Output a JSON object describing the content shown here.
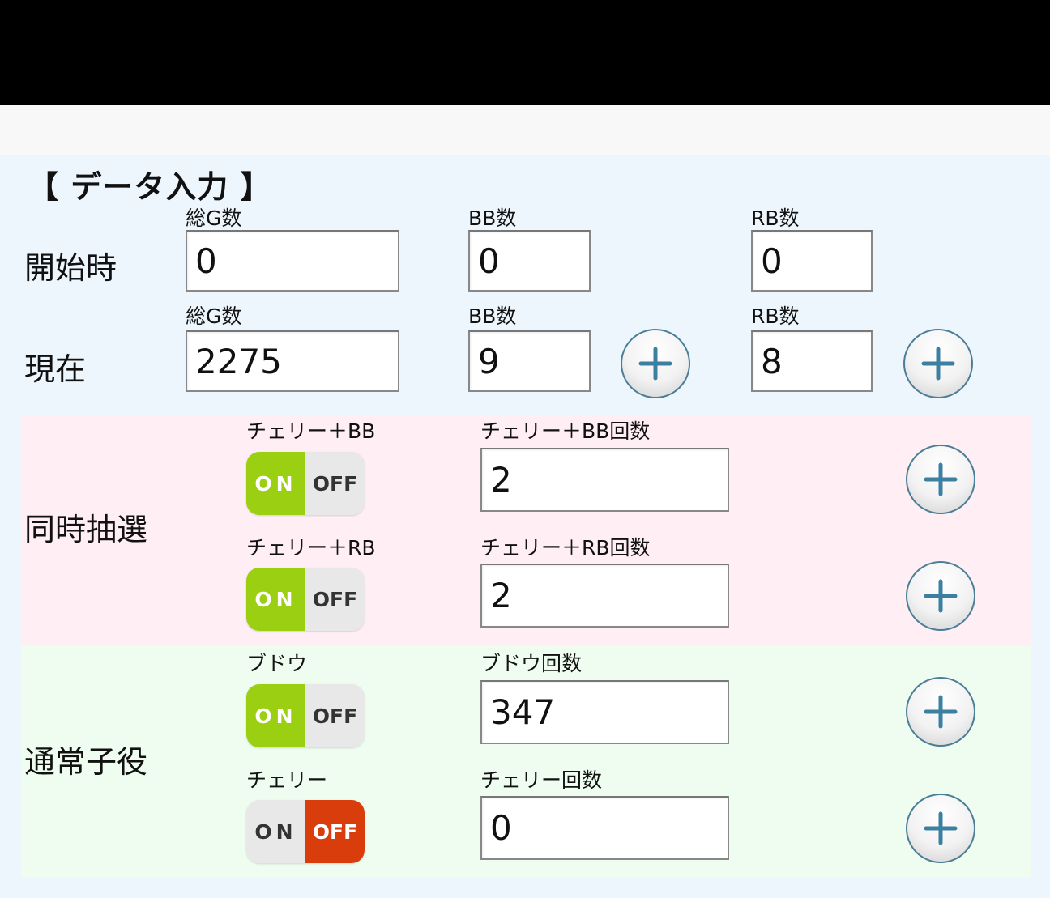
{
  "section_title": "【 データ入力 】",
  "start": {
    "row_label": "開始時",
    "total_games": {
      "label": "総G数",
      "value": "0"
    },
    "bb": {
      "label": "BB数",
      "value": "0"
    },
    "rb": {
      "label": "RB数",
      "value": "0"
    }
  },
  "current": {
    "row_label": "現在",
    "total_games": {
      "label": "総G数",
      "value": "2275"
    },
    "bb": {
      "label": "BB数",
      "value": "9"
    },
    "rb": {
      "label": "RB数",
      "value": "8"
    }
  },
  "simultaneous": {
    "row_label": "同時抽選",
    "items": [
      {
        "toggle_label": "チェリー＋BB",
        "count_label": "チェリー＋BB回数",
        "value": "2",
        "state": "on",
        "on_text": "ON",
        "off_text": "OFF"
      },
      {
        "toggle_label": "チェリー＋RB",
        "count_label": "チェリー＋RB回数",
        "value": "2",
        "state": "on",
        "on_text": "ON",
        "off_text": "OFF"
      }
    ]
  },
  "normal_roles": {
    "row_label": "通常子役",
    "items": [
      {
        "toggle_label": "ブドウ",
        "count_label": "ブドウ回数",
        "value": "347",
        "state": "on",
        "on_text": "ON",
        "off_text": "OFF"
      },
      {
        "toggle_label": "チェリー",
        "count_label": "チェリー回数",
        "value": "0",
        "state": "off",
        "on_text": "ON",
        "off_text": "OFF"
      }
    ]
  },
  "colors": {
    "toggle_on": "#9bcf12",
    "toggle_off": "#d93d0b",
    "plus_border": "#4a7d96",
    "plus_icon": "#3c7fa0",
    "simultaneous_bg": "#ffeef3",
    "normal_bg": "#effdf0",
    "page_bg": "#eef6fd"
  },
  "icons": {
    "plus": "plus-icon"
  }
}
